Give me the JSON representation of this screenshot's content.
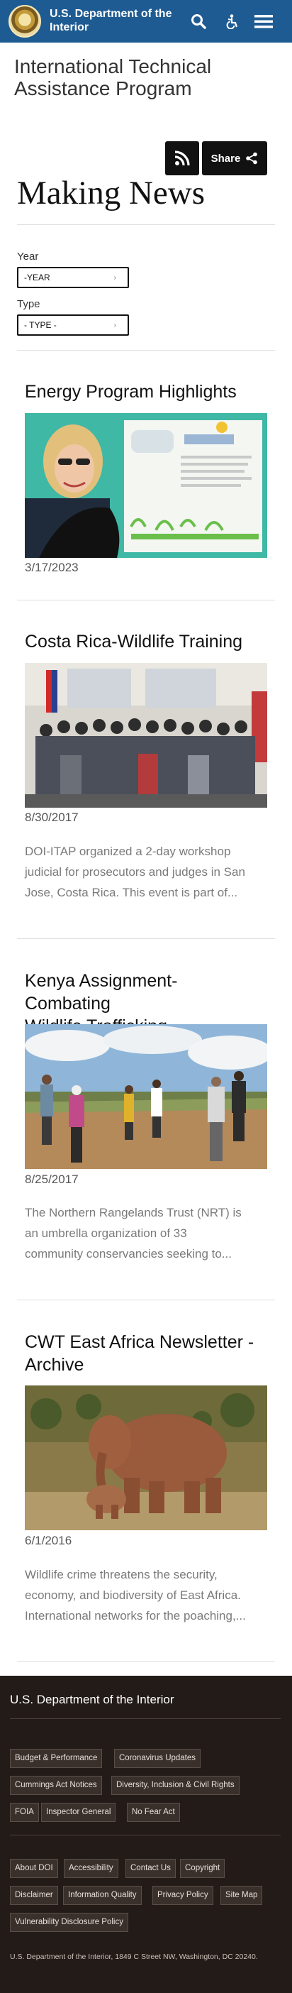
{
  "header": {
    "brand_line1": "U.S. Department of the",
    "brand_line2": "Interior",
    "icons": [
      "search-icon",
      "accessibility-icon",
      "menu-icon"
    ],
    "color": "#1e5b92"
  },
  "program_title_line1": "International Technical",
  "program_title_line2": "Assistance Program",
  "share": {
    "label": "Share"
  },
  "page_title": "Making News",
  "filters": {
    "year_label": "Year",
    "year_value": "-YEAR",
    "type_label": "Type",
    "type_value": "- TYPE -"
  },
  "articles": [
    {
      "title": "Energy Program Highlights",
      "date": "3/17/2023",
      "summary_line1": "",
      "summary_line2": "",
      "summary_line3": ""
    },
    {
      "title": "Costa Rica-Wildlife Training",
      "date": "8/30/2017",
      "summary_line1": "DOI-ITAP organized a 2-day workshop",
      "summary_line2": "judicial for prosecutors and judges in San",
      "summary_line3": "Jose, Costa Rica.  This event is part of..."
    },
    {
      "title_line1": "Kenya Assignment- Combating",
      "title_line2": "Wildlife Trafficking",
      "date": "8/25/2017",
      "summary_line1": "The Northern Rangelands Trust (NRT) is",
      "summary_line2": "an umbrella organization of 33",
      "summary_line3": "community conservancies seeking to..."
    },
    {
      "title_line1": "CWT East Africa Newsletter -",
      "title_line2": "Archive",
      "date": "6/1/2016",
      "summary_line1": "Wildlife crime threatens the security,",
      "summary_line2": "economy, and biodiversity of East Africa.",
      "summary_line3": "International networks for the poaching,..."
    }
  ],
  "footer": {
    "title": "U.S. Department of the Interior",
    "links_group1": [
      "Budget & Performance",
      "Coronavirus Updates",
      "Cummings Act Notices",
      "Diversity, Inclusion & Civil Rights",
      "FOIA",
      "Inspector General",
      "No Fear Act"
    ],
    "links_group2": [
      "About DOI",
      "Accessibility",
      "Contact Us",
      "Copyright",
      "Disclaimer",
      "Information Quality",
      "Privacy Policy",
      "Site Map",
      "Vulnerability Disclosure Policy"
    ],
    "address": "U.S. Department of the Interior, 1849 C Street NW, Washington, DC 20240."
  }
}
